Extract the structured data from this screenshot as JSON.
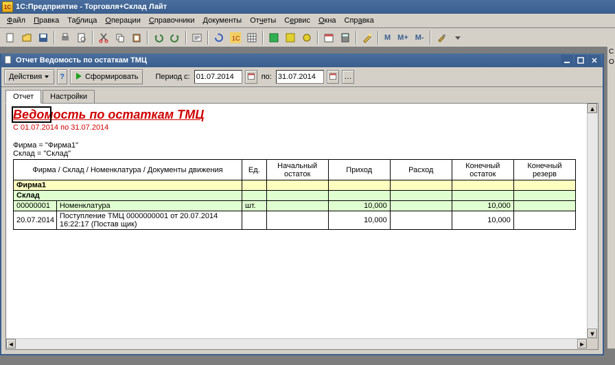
{
  "app": {
    "title": "1С:Предприятие - Торговля+Склад Лайт"
  },
  "menu": {
    "file": "Файл",
    "edit": "Правка",
    "table": "Таблица",
    "operations": "Операции",
    "refs": "Справочники",
    "docs": "Документы",
    "reports": "Отчеты",
    "service": "Сервис",
    "windows": "Окна",
    "help": "Справка"
  },
  "toolbar_text": {
    "m": "M",
    "mplus": "M+",
    "mminus": "M-"
  },
  "child": {
    "title": "Отчет  Ведомость по остаткам ТМЦ",
    "actions": "Действия",
    "form": "Сформировать",
    "period_from_label": "Период с:",
    "period_from": "01.07.2014",
    "period_to_label": "по:",
    "period_to": "31.07.2014"
  },
  "tabs": {
    "report": "Отчет",
    "settings": "Настройки"
  },
  "report": {
    "title": "Ведомость по остаткам ТМЦ",
    "period": "С 01.07.2014 по 31.07.2014",
    "filter_firma": "Фирма = \"Фирма1\"",
    "filter_sklad": "Склад = \"Склад\"",
    "headers": {
      "group": "Фирма / Склад / Номенклатура / Документы движения",
      "unit": "Ед.",
      "start": "Начальный остаток",
      "in": "Приход",
      "out": "Расход",
      "end": "Конечный остаток",
      "reserve": "Конечный резерв"
    },
    "rows": {
      "firma": "Фирма1",
      "sklad": "Склад",
      "nomen_code": "00000001",
      "nomen_name": "Номенклатура",
      "nomen_unit": "шт.",
      "nomen_in": "10,000",
      "nomen_end": "10,000",
      "doc_date": "20.07.2014",
      "doc_desc": "Поступление ТМЦ 0000000001 от 20.07.2014 16:22:17 (Постав щик)",
      "doc_in": "10,000",
      "doc_end": "10,000"
    }
  },
  "right": {
    "c": "C",
    "o": "O"
  }
}
